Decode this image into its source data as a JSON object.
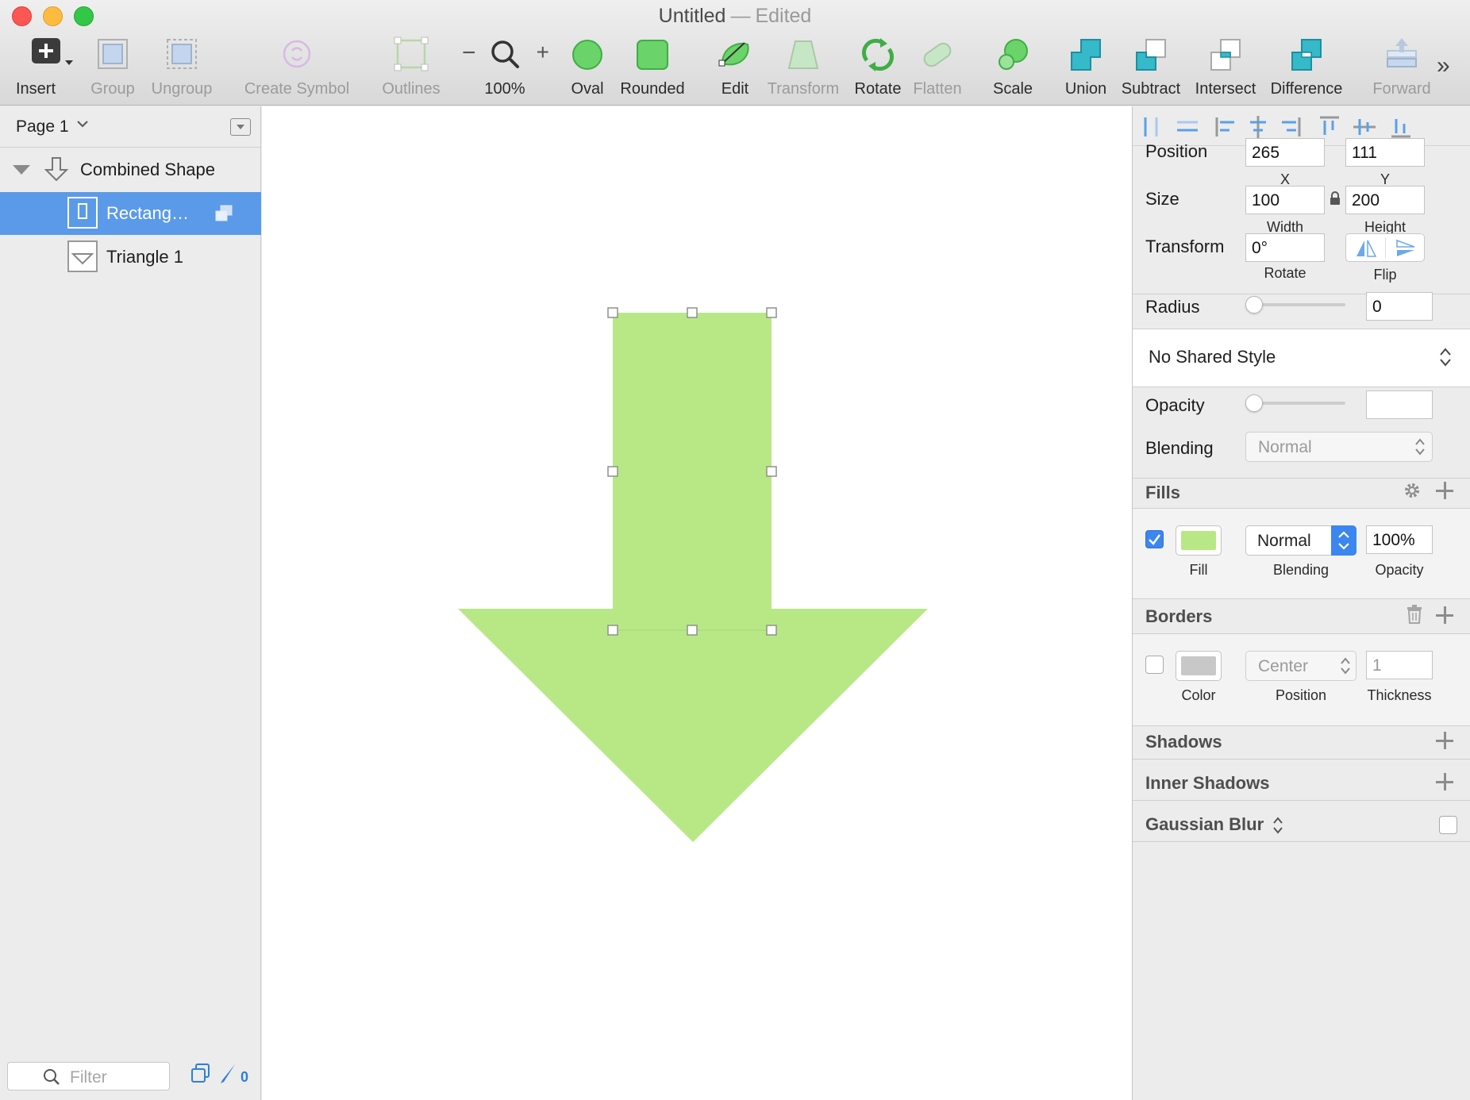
{
  "window": {
    "title": "Untitled",
    "separator": "—",
    "status": "Edited"
  },
  "toolbar": {
    "insert": "Insert",
    "group": "Group",
    "ungroup": "Ungroup",
    "create_symbol": "Create Symbol",
    "outlines": "Outlines",
    "zoom_minus": "−",
    "zoom_level": "100%",
    "zoom_plus": "+",
    "oval": "Oval",
    "rounded": "Rounded",
    "edit": "Edit",
    "transform": "Transform",
    "rotate": "Rotate",
    "flatten": "Flatten",
    "scale": "Scale",
    "union": "Union",
    "subtract": "Subtract",
    "intersect": "Intersect",
    "difference": "Difference",
    "forward": "Forward",
    "more": "»"
  },
  "sidebar": {
    "page": "Page 1",
    "layers": [
      {
        "name": "Combined Shape",
        "selected": false
      },
      {
        "name": "Rectang…",
        "selected": true
      },
      {
        "name": "Triangle 1",
        "selected": false
      }
    ],
    "filter_placeholder": "Filter",
    "slice_count": "0"
  },
  "canvas": {
    "shape_color": "#b8e886",
    "shape_edge": "#a3d774",
    "handle_color": "#ffffff"
  },
  "inspector": {
    "position": {
      "label": "Position",
      "x": "265",
      "y": "111",
      "x_label": "X",
      "y_label": "Y"
    },
    "size": {
      "label": "Size",
      "width": "100",
      "height": "200",
      "width_label": "Width",
      "height_label": "Height"
    },
    "transform": {
      "label": "Transform",
      "rotate": "0°",
      "rotate_label": "Rotate",
      "flip_label": "Flip"
    },
    "radius": {
      "label": "Radius",
      "value": "0"
    },
    "shared_style": "No Shared Style",
    "opacity": {
      "label": "Opacity",
      "value": ""
    },
    "blending": {
      "label": "Blending",
      "value": "Normal"
    },
    "fills": {
      "title": "Fills",
      "enabled": true,
      "color": "#b8e886",
      "blending": "Normal",
      "opacity": "100%",
      "fill_label": "Fill",
      "blending_label": "Blending",
      "opacity_label": "Opacity"
    },
    "borders": {
      "title": "Borders",
      "enabled": false,
      "color": "#c8c8c8",
      "position": "Center",
      "thickness": "1",
      "color_label": "Color",
      "position_label": "Position",
      "thickness_label": "Thickness"
    },
    "shadows": "Shadows",
    "inner_shadows": "Inner Shadows",
    "gaussian_blur": "Gaussian Blur"
  }
}
